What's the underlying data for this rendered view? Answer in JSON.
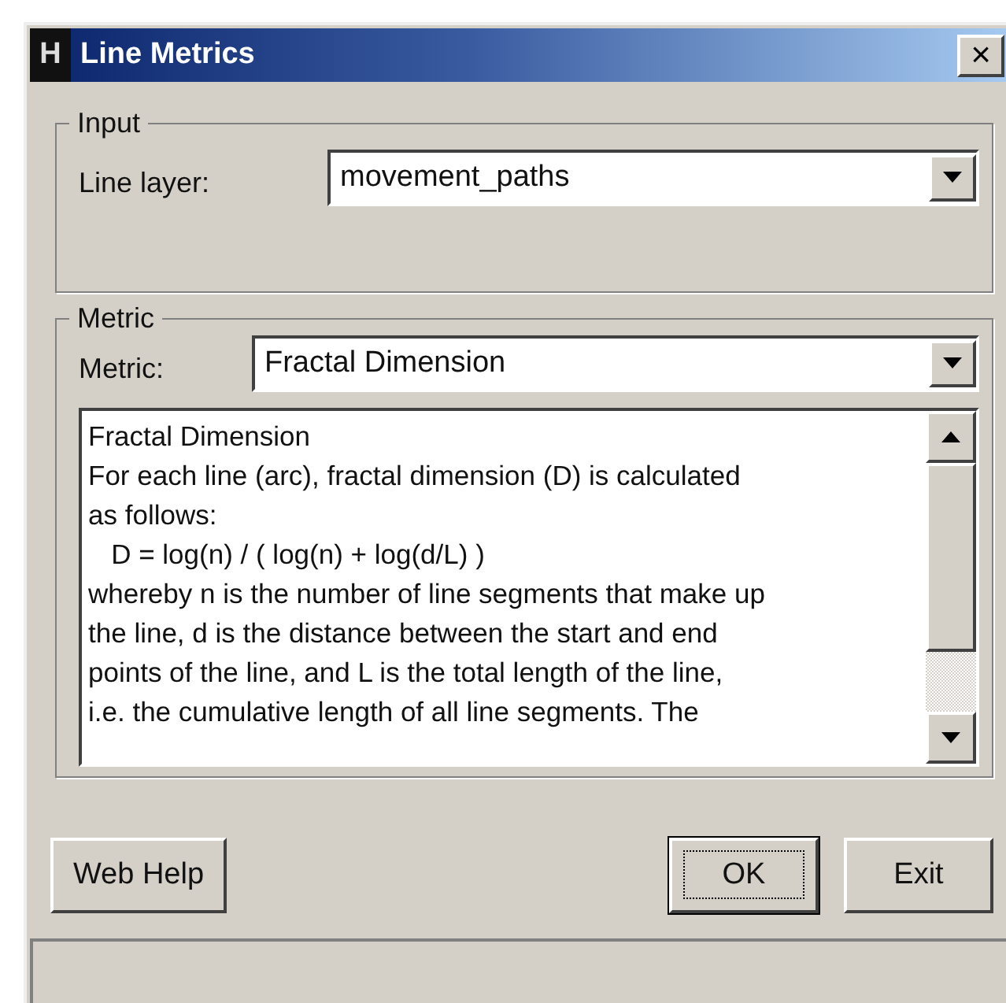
{
  "window": {
    "icon_letter": "H",
    "title": "Line Metrics",
    "close": "×"
  },
  "input_group": {
    "title": "Input",
    "label": "Line layer:",
    "value": "movement_paths"
  },
  "metric_group": {
    "title": "Metric",
    "label": "Metric:",
    "value": "Fractal Dimension",
    "description_lines": [
      "Fractal Dimension",
      "For each line (arc), fractal dimension (D) is calculated",
      "as follows:",
      "   D = log(n) / ( log(n) + log(d/L) )",
      "whereby n is the number of line segments that make up",
      "the line, d is the distance between the start and end",
      "points of the line, and L is the total length of the line,",
      "i.e. the cumulative length of all line segments. The"
    ]
  },
  "buttons": [
    {
      "label": "Web Help",
      "default": false
    },
    {
      "label": "OK",
      "default": true
    },
    {
      "label": "Exit",
      "default": false
    }
  ]
}
